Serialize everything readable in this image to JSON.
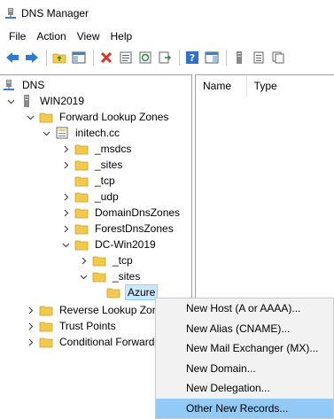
{
  "window": {
    "title": "DNS Manager"
  },
  "menubar": {
    "items": [
      "File",
      "Action",
      "View",
      "Help"
    ]
  },
  "list": {
    "columns": [
      "Name",
      "Type"
    ]
  },
  "tree": {
    "root": "DNS",
    "server": "WIN2019",
    "forward_zones": "Forward Lookup Zones",
    "zone": "initech.cc",
    "msdcs": "_msdcs",
    "sites": "_sites",
    "tcp": "_tcp",
    "udp": "_udp",
    "domaindns": "DomainDnsZones",
    "forestdns": "ForestDnsZones",
    "dc": "DC-Win2019",
    "dc_tcp": "_tcp",
    "dc_sites": "_sites",
    "azure": "Azure",
    "reverse_zones": "Reverse Lookup Zon",
    "trust_points": "Trust Points",
    "conditional": "Conditional Forward"
  },
  "context_menu": {
    "items": [
      "New Host (A or AAAA)...",
      "New Alias (CNAME)...",
      "New Mail Exchanger (MX)...",
      "New Domain...",
      "New Delegation...",
      "Other New Records..."
    ],
    "highlighted": "Other New Records..."
  },
  "colors": {
    "folder": "#f2c94c",
    "selection": "#cce8ff",
    "menu_highlight": "#91c9f7",
    "nav_arrow": "#2e7bd6",
    "delete_x": "#d9312b"
  }
}
